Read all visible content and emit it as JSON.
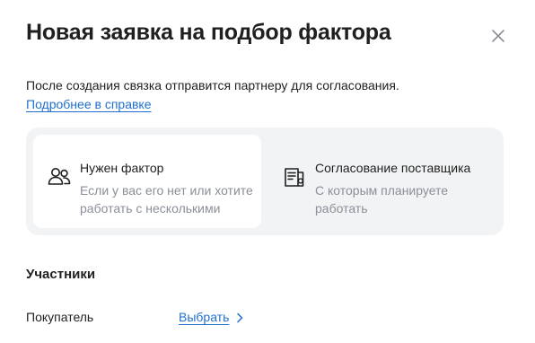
{
  "modal": {
    "title": "Новая заявка на подбор фактора",
    "close_icon": "close-icon"
  },
  "intro": {
    "description": "После создания связка отправится партнеру для согласования.",
    "help_link": "Подробнее в справке"
  },
  "options": [
    {
      "icon": "users-icon",
      "title": "Нужен фактор",
      "subtitle": "Если у вас его нет или хотите работать с несколькими",
      "selected": true
    },
    {
      "icon": "documents-icon",
      "title": "Согласование поставщика",
      "subtitle": "С которым планируете работать",
      "selected": false
    }
  ],
  "participants": {
    "title": "Участники",
    "rows": [
      {
        "label": "Покупатель",
        "action": "Выбрать"
      }
    ]
  },
  "colors": {
    "link": "#1f6fd1",
    "text": "#1f1f1f",
    "muted": "#8a8f98",
    "panel": "#f2f3f5"
  }
}
